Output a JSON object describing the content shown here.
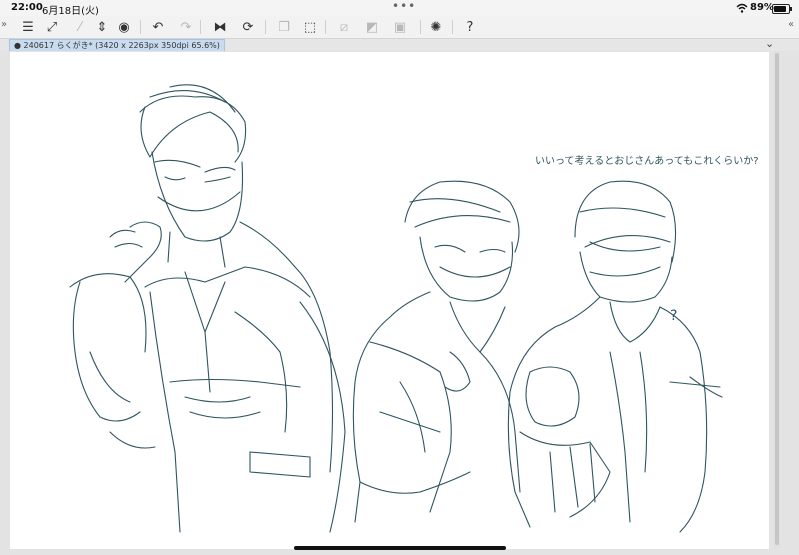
{
  "status_bar": {
    "time": "22:00",
    "date": "6月18日(火)",
    "battery_pct": "89%",
    "battery_level": 0.89
  },
  "toolbar": {
    "buttons": [
      {
        "icon": "menu-icon",
        "glyph": "☰",
        "enabled": true
      },
      {
        "icon": "canvas-resize-icon",
        "glyph": "⤢",
        "enabled": true
      },
      {
        "icon": "eyedropper-icon",
        "glyph": "⁄",
        "enabled": false
      },
      {
        "icon": "scroll-icon",
        "glyph": "⇕",
        "enabled": true
      },
      {
        "icon": "color-wheel-icon",
        "glyph": "◉",
        "enabled": true
      },
      {
        "icon": "undo-icon",
        "glyph": "↶",
        "enabled": true
      },
      {
        "icon": "redo-icon",
        "glyph": "↷",
        "enabled": false
      },
      {
        "icon": "flip-horizontal-icon",
        "glyph": "⧓",
        "enabled": true
      },
      {
        "icon": "rotate-icon",
        "glyph": "⟳",
        "enabled": true
      },
      {
        "icon": "copy-layer-icon",
        "glyph": "❐",
        "enabled": false
      },
      {
        "icon": "transform-icon",
        "glyph": "⬚",
        "enabled": true
      },
      {
        "icon": "clear-icon",
        "glyph": "⧄",
        "enabled": false
      },
      {
        "icon": "fill-icon",
        "glyph": "◩",
        "enabled": false
      },
      {
        "icon": "select-all-icon",
        "glyph": "▣",
        "enabled": false
      },
      {
        "icon": "loading-icon",
        "glyph": "✺",
        "enabled": true
      },
      {
        "icon": "help-icon",
        "glyph": "?",
        "enabled": true
      }
    ],
    "left_arrow": "»",
    "right_arrow": "«"
  },
  "tab": {
    "label": "● 240617 らくがき* (3420 x 2263px 350dpi 65.6%)",
    "menu_glyph": "⌄"
  },
  "canvas": {
    "handwritten_note_line1": "いいって考えるとおじさんあってもこれくらいか?",
    "handwritten_note_line2": "",
    "question_mark": "?",
    "stroke_color": "#2f5560"
  }
}
